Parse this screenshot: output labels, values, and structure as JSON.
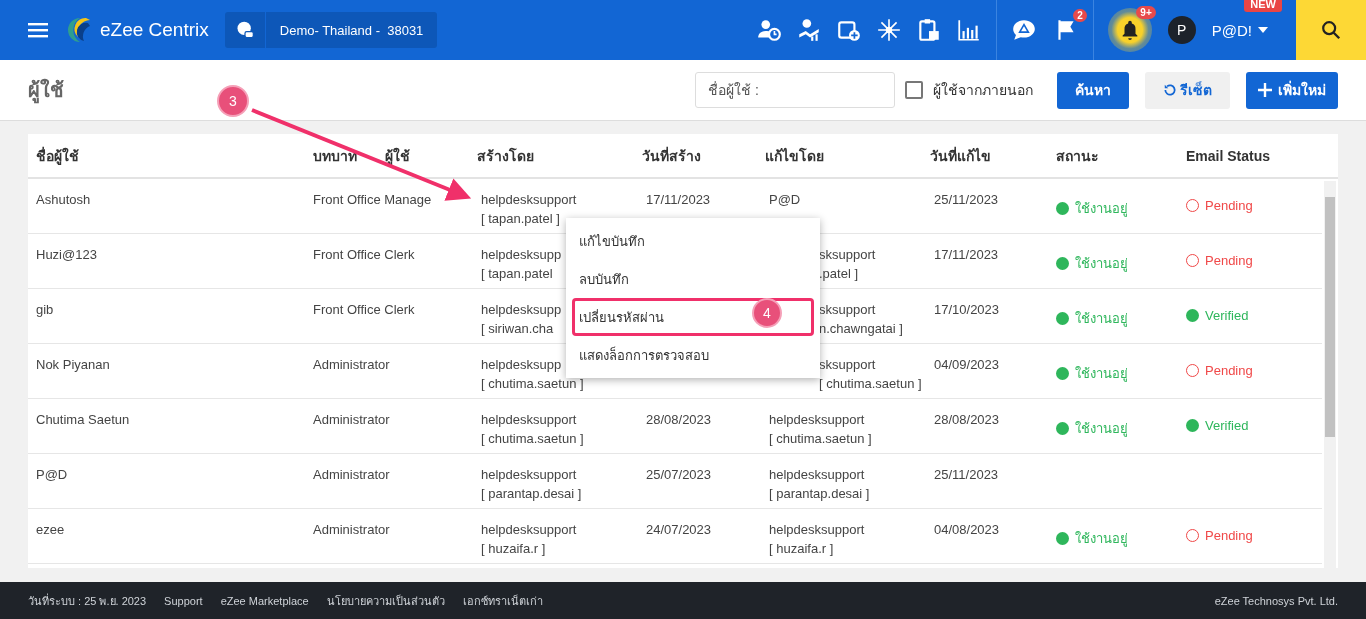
{
  "topbar": {
    "brand": "eZee Centrix",
    "property": "Demo- Thailand -  38031",
    "flag_badge": "2",
    "bell_badge": "9+",
    "avatar": "P",
    "user": "P@D!",
    "new_badge": "NEW"
  },
  "page": {
    "title": "ผู้ใช้",
    "filter_label": "ชื่อผู้ใช้ :",
    "external": {
      "label": "ผู้ใช้จากภายนอก",
      "checked": false
    },
    "search_button": "ค้นหา",
    "reset_button": "รีเซ็ต",
    "add_button": "เพิ่มใหม่"
  },
  "table": {
    "columns": [
      "ชื่อผู้ใช้",
      [
        "บทบาท",
        "ผู้ใช้"
      ],
      "สร้างโดย",
      "วันที่สร้าง",
      "แก้ไขโดย",
      "วันที่แก้ไข",
      "สถานะ",
      "Email Status"
    ],
    "rows": [
      {
        "user": "Ashutosh",
        "role": "Front Office Manage",
        "created_by": [
          "helpdesksupport",
          "[ tapan.patel ]"
        ],
        "created": "17/11/2023",
        "modified_by": [
          "P@D"
        ],
        "modified": "25/11/2023",
        "status": "ใช้งานอยู่",
        "email": {
          "kind": "pending",
          "label": "Pending"
        }
      },
      {
        "user": "Huzi@123",
        "role": "Front Office Clerk",
        "created_by": [
          "helpdesksupp",
          "[ tapan.patel"
        ],
        "modified_by": [
          "sksupport",
          ".patel ]"
        ],
        "modified_cut": true,
        "modified": "17/11/2023",
        "status": "ใช้งานอยู่",
        "email": {
          "kind": "pending",
          "label": "Pending"
        }
      },
      {
        "user": "gib",
        "role": "Front Office Clerk",
        "created_by": [
          "helpdesksupp",
          "[ siriwan.cha"
        ],
        "modified_by": [
          "sksupport",
          "n.chawngatai ]"
        ],
        "modified_cut": true,
        "modified": "17/10/2023",
        "status": "ใช้งานอยู่",
        "email": {
          "kind": "verified",
          "label": "Verified"
        }
      },
      {
        "user": "Nok Piyanan",
        "role": "Administrator",
        "created_by": [
          "helpdesksupp",
          "[ chutima.saetun ]"
        ],
        "modified_by": [
          "sksupport",
          "[ chutima.saetun ]"
        ],
        "modified_cut": true,
        "modified": "04/09/2023",
        "status": "ใช้งานอยู่",
        "email": {
          "kind": "pending",
          "label": "Pending"
        }
      },
      {
        "user": "Chutima Saetun",
        "role": "Administrator",
        "created_by": [
          "helpdesksupport",
          "[ chutima.saetun ]"
        ],
        "created": "28/08/2023",
        "modified_by": [
          "helpdesksupport",
          "[ chutima.saetun ]"
        ],
        "modified": "28/08/2023",
        "status": "ใช้งานอยู่",
        "email": {
          "kind": "verified",
          "label": "Verified"
        }
      },
      {
        "user": "P@D",
        "role": "Administrator",
        "created_by": [
          "helpdesksupport",
          "[ parantap.desai ]"
        ],
        "created": "25/07/2023",
        "modified_by": [
          "helpdesksupport",
          "[ parantap.desai ]"
        ],
        "modified": "25/11/2023"
      },
      {
        "user": "ezee",
        "role": "Administrator",
        "created_by": [
          "helpdesksupport",
          "[ huzaifa.r ]"
        ],
        "created": "24/07/2023",
        "modified_by": [
          "helpdesksupport",
          "[ huzaifa.r ]"
        ],
        "modified": "04/08/2023",
        "status": "ใช้งานอยู่",
        "email": {
          "kind": "pending",
          "label": "Pending"
        }
      }
    ]
  },
  "context_menu": [
    {
      "label": "แก้ไขบันทึก",
      "highlighted": false
    },
    {
      "label": "ลบบันทึก",
      "highlighted": false
    },
    {
      "label": "เปลี่ยนรหัสผ่าน",
      "highlighted": true
    },
    {
      "label": "แสดงล็อกการตรวจสอบ",
      "highlighted": false
    }
  ],
  "annotations": [
    {
      "kind": "arrow-step",
      "label": "3"
    },
    {
      "kind": "menu-step",
      "label": "4"
    }
  ],
  "footer": {
    "links": [
      "วันที่ระบบ : 25 พ.ย. 2023",
      "Support",
      "eZee Marketplace",
      "นโยบายความเป็นส่วนตัว",
      "เอกซ์ทราเน็ตเก่า"
    ],
    "company": "eZee Technosys Pvt. Ltd."
  }
}
